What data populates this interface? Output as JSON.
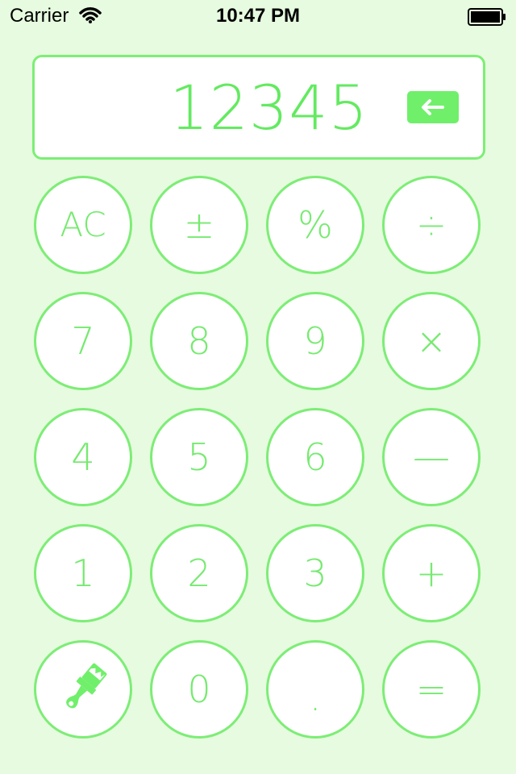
{
  "status_bar": {
    "carrier": "Carrier",
    "time": "10:47 PM",
    "wifi_icon": "wifi-icon",
    "battery_icon": "battery-icon"
  },
  "display": {
    "value": "12345",
    "backspace_icon": "backspace-arrow-icon"
  },
  "keys": {
    "row1": [
      "AC",
      "±",
      "%",
      "÷"
    ],
    "row2": [
      "7",
      "8",
      "9",
      "×"
    ],
    "row3": [
      "4",
      "5",
      "6",
      "—"
    ],
    "row4": [
      "1",
      "2",
      "3",
      "+"
    ],
    "row5": [
      "",
      "0",
      ".",
      "="
    ]
  },
  "icons": {
    "paint_brush": "paint-brush-icon"
  },
  "colors": {
    "background": "#e6fbdf",
    "accent": "#70ef6b",
    "key_text": "#76ea70",
    "key_border": "#7ded76"
  }
}
